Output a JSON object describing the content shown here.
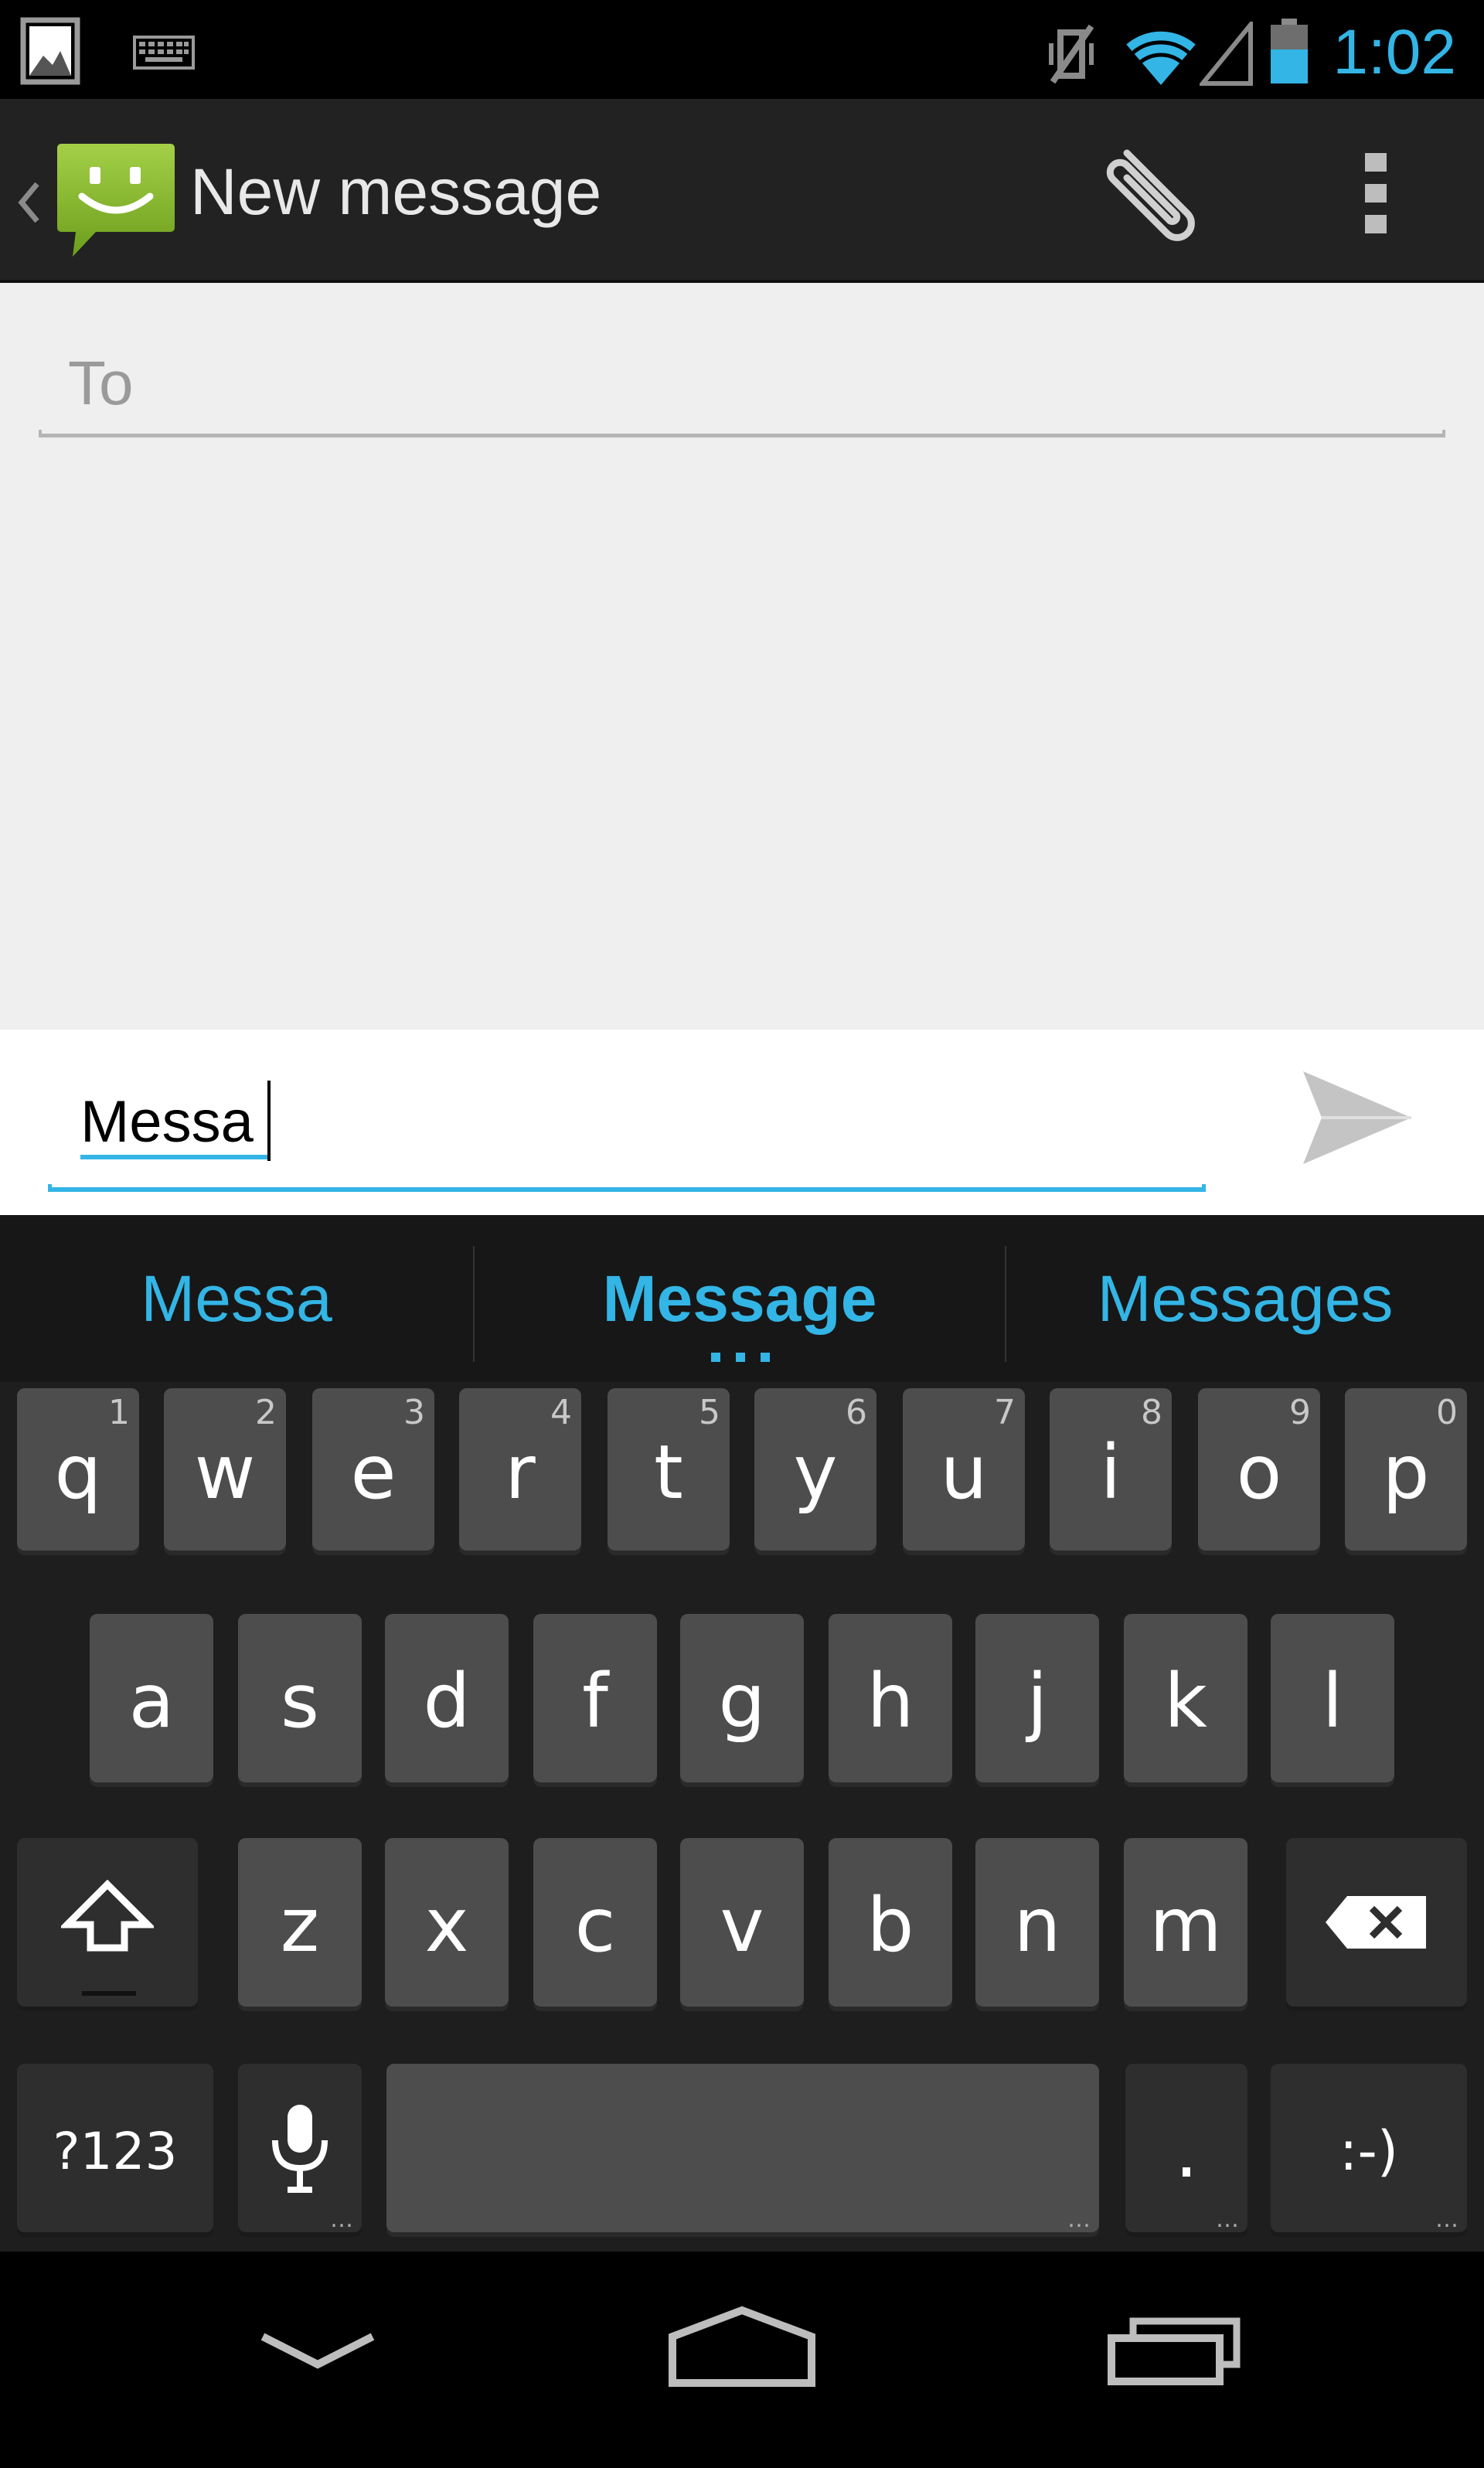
{
  "status_bar": {
    "time": "1:02",
    "icons": [
      "picture-notification-icon",
      "keyboard-notification-icon",
      "vibrate-mute-icon",
      "wifi-icon",
      "signal-icon",
      "battery-icon"
    ]
  },
  "action_bar": {
    "title": "New message",
    "icons": [
      "back-chevron-icon",
      "messaging-app-icon",
      "attach-paperclip-icon",
      "overflow-menu-icon"
    ]
  },
  "recipient": {
    "placeholder": "To",
    "value": ""
  },
  "compose": {
    "text": "Messa",
    "send_icon": "send-icon"
  },
  "suggestions": {
    "items": [
      "Messa",
      "Message",
      "Messages"
    ],
    "selected": "Message",
    "color": "#33b5e5"
  },
  "keyboard": {
    "row1": [
      {
        "label": "q",
        "hint": "1"
      },
      {
        "label": "w",
        "hint": "2"
      },
      {
        "label": "e",
        "hint": "3"
      },
      {
        "label": "r",
        "hint": "4"
      },
      {
        "label": "t",
        "hint": "5"
      },
      {
        "label": "y",
        "hint": "6"
      },
      {
        "label": "u",
        "hint": "7"
      },
      {
        "label": "i",
        "hint": "8"
      },
      {
        "label": "o",
        "hint": "9"
      },
      {
        "label": "p",
        "hint": "0"
      }
    ],
    "row2": [
      "a",
      "s",
      "d",
      "f",
      "g",
      "h",
      "j",
      "k",
      "l"
    ],
    "row3": [
      "z",
      "x",
      "c",
      "v",
      "b",
      "n",
      "m"
    ],
    "symbols_label": "?123",
    "period_label": ".",
    "smiley_label": ":-)",
    "special_icons": [
      "shift-icon",
      "backspace-icon",
      "microphone-icon"
    ]
  },
  "nav_bar": {
    "icons": [
      "back-down-icon",
      "home-icon",
      "recent-apps-icon"
    ]
  }
}
